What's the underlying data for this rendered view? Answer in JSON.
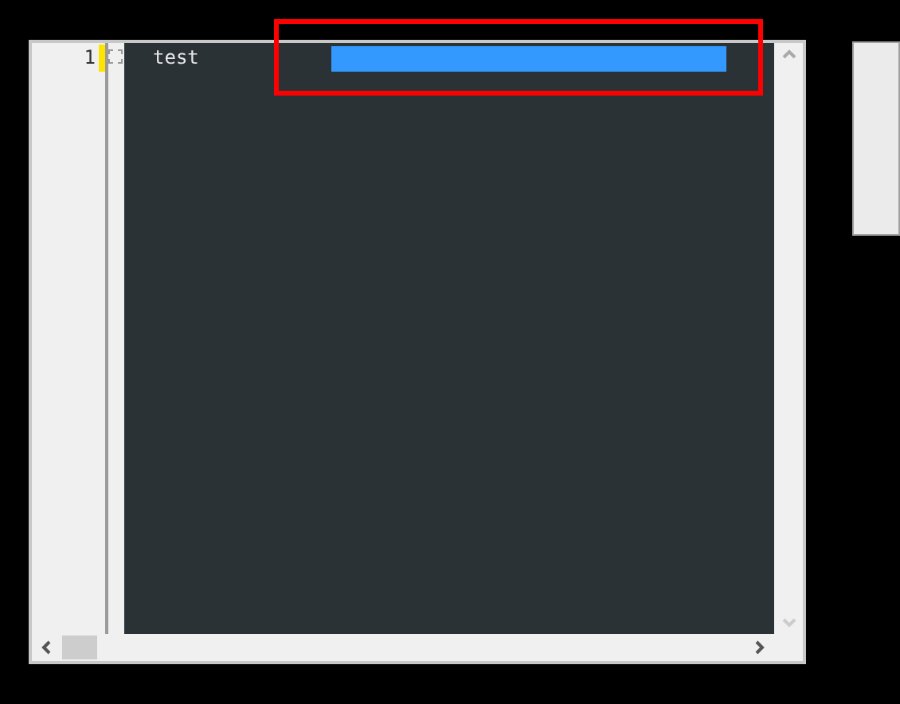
{
  "editor": {
    "lines": [
      {
        "number": "1",
        "text": "test",
        "current": true
      }
    ]
  }
}
